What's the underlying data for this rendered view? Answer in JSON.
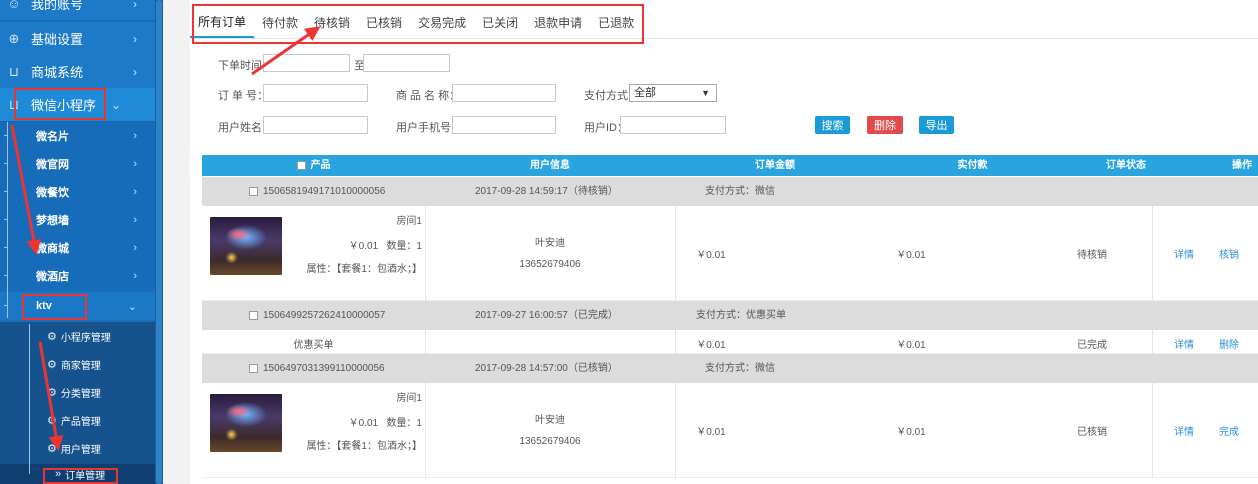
{
  "sidebar": {
    "top_items": [
      {
        "label": "我的账号",
        "icon": "user-icon"
      },
      {
        "label": "基础设置",
        "icon": "globe-icon"
      },
      {
        "label": "商城系统",
        "icon": "cart-icon"
      },
      {
        "label": "微信小程序",
        "icon": "cart-icon"
      }
    ],
    "sub_items": [
      {
        "label": "微名片"
      },
      {
        "label": "微官网"
      },
      {
        "label": "微餐饮"
      },
      {
        "label": "梦想墙"
      },
      {
        "label": "微商城"
      },
      {
        "label": "微酒店"
      },
      {
        "label": "ktv"
      }
    ],
    "ktv_items": [
      {
        "label": "小程序管理"
      },
      {
        "label": "商家管理"
      },
      {
        "label": "分类管理"
      },
      {
        "label": "产品管理"
      },
      {
        "label": "用户管理"
      },
      {
        "label": "订单管理"
      }
    ],
    "arrow_right": "›",
    "arrow_down": "⌄"
  },
  "tabs": [
    "所有订单",
    "待付款",
    "待核销",
    "已核销",
    "交易完成",
    "已关闭",
    "退款申请",
    "已退款"
  ],
  "filters": {
    "order_time_label": "下单时间：",
    "to_label": "至",
    "order_no_label": "订 单 号：",
    "product_name_label": "商 品 名 称：",
    "payment_label": "支付方式：",
    "payment_selected": "全部",
    "username_label": "用户姓名：",
    "phone_label": "用户手机号：",
    "userid_label": "用户ID："
  },
  "buttons": {
    "search": "搜索",
    "delete": "删除",
    "export": "导出"
  },
  "table": {
    "headers": [
      "产品",
      "用户信息",
      "订单金额",
      "实付款",
      "订单状态",
      "操作"
    ],
    "orders": [
      {
        "order_no": "15065819491710100000​56",
        "time": "2017-09-28 14:59:17（待核销）",
        "pay": "支付方式：微信",
        "room": "房间1",
        "price": "￥0.01",
        "qty": "数量：1",
        "attr": "属性：【套餐1：包酒水；】",
        "user": "叶安迪",
        "phone": "13652679406",
        "amount": "￥0.01",
        "paid": "￥0.01",
        "status": "待核销",
        "op1": "详情",
        "op2": "核销"
      },
      {
        "order_no": "1506499257262410000057",
        "time": "2017-09-27 16:00:57（已完成）",
        "pay": "支付方式：优惠买单",
        "product": "优惠买单",
        "amount": "￥0.01",
        "paid": "￥0.01",
        "status": "已完成",
        "op1": "详情",
        "op2": "删除"
      },
      {
        "order_no": "1506497031399110000056",
        "time": "2017-09-28 14:57:00（已核销）",
        "pay": "支付方式：微信",
        "room": "房间1",
        "price": "￥0.01",
        "qty": "数量：1",
        "attr": "属性：【套餐1：包酒水；】",
        "user": "叶安迪",
        "phone": "13652679406",
        "amount": "￥0.01",
        "paid": "￥0.01",
        "status": "已核销",
        "op1": "详情",
        "op2": "完成"
      }
    ]
  },
  "colors": {
    "sidebar": "#1a6db8",
    "table_header": "#29a4de",
    "search_btn": "#1a9ad6",
    "delete_btn": "#e04a4a",
    "annotation": "#e33333"
  }
}
